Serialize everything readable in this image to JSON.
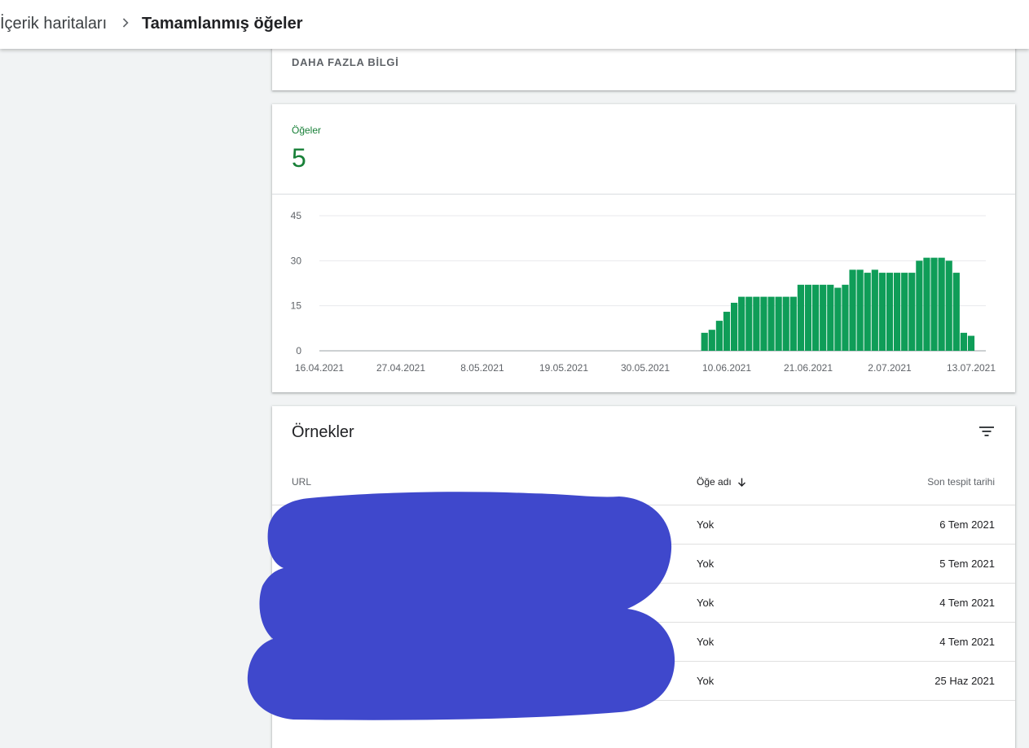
{
  "breadcrumb": {
    "parent": "İçerik haritaları",
    "current": "Tamamlanmış öğeler"
  },
  "info_card": {
    "more_info": "DAHA FAZLA BİLGİ"
  },
  "metric": {
    "label": "Öğeler",
    "value": "5",
    "color": "#188038"
  },
  "chart_data": {
    "type": "bar",
    "bar_color": "#0f9d58",
    "ylim": [
      0,
      45
    ],
    "yticks": [
      "0",
      "15",
      "30",
      "45"
    ],
    "xticks": [
      "16.04.2021",
      "27.04.2021",
      "8.05.2021",
      "19.05.2021",
      "30.05.2021",
      "10.06.2021",
      "21.06.2021",
      "2.07.2021",
      "13.07.2021"
    ],
    "categories": [
      "2021-06-07",
      "2021-06-08",
      "2021-06-09",
      "2021-06-10",
      "2021-06-11",
      "2021-06-12",
      "2021-06-13",
      "2021-06-14",
      "2021-06-15",
      "2021-06-16",
      "2021-06-17",
      "2021-06-18",
      "2021-06-19",
      "2021-06-20",
      "2021-06-21",
      "2021-06-22",
      "2021-06-23",
      "2021-06-24",
      "2021-06-25",
      "2021-06-26",
      "2021-06-27",
      "2021-06-28",
      "2021-06-29",
      "2021-06-30",
      "2021-07-01",
      "2021-07-02",
      "2021-07-03",
      "2021-07-04",
      "2021-07-05",
      "2021-07-06",
      "2021-07-07",
      "2021-07-08",
      "2021-07-09",
      "2021-07-10",
      "2021-07-11",
      "2021-07-12",
      "2021-07-13"
    ],
    "values": [
      6,
      7,
      10,
      13,
      16,
      18,
      18,
      18,
      18,
      18,
      18,
      18,
      18,
      22,
      22,
      22,
      22,
      22,
      21,
      22,
      27,
      27,
      26,
      27,
      26,
      26,
      26,
      26,
      26,
      30,
      31,
      31,
      31,
      30,
      26,
      6,
      5
    ]
  },
  "examples": {
    "title": "Örnekler",
    "filter_icon": "filter-icon",
    "columns": {
      "url": "URL",
      "name": "Öğe adı",
      "date": "Son tespit tarihi"
    },
    "rows": [
      {
        "name": "Yok",
        "date": "6 Tem 2021"
      },
      {
        "name": "Yok",
        "date": "5 Tem 2021"
      },
      {
        "name": "Yok",
        "date": "4 Tem 2021"
      },
      {
        "name": "Yok",
        "date": "4 Tem 2021"
      },
      {
        "name": "Yok",
        "date": "25 Haz 2021"
      }
    ]
  },
  "redaction_color": "#3f48cc"
}
